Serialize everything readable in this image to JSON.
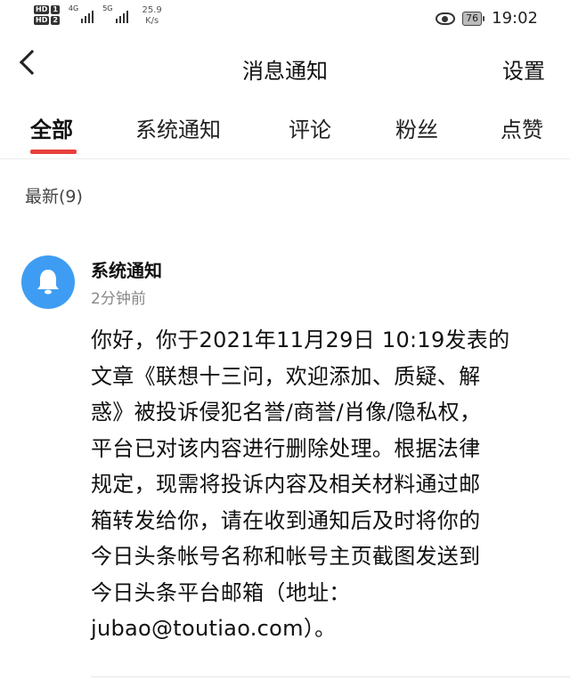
{
  "status_bar": {
    "hd1": "HD",
    "hd1_num": "1",
    "hd2": "HD",
    "hd2_num": "2",
    "net1": "4G",
    "net2": "5G",
    "speed_value": "25.9",
    "speed_unit": "K/s",
    "battery": "76",
    "time": "19:02"
  },
  "header": {
    "title": "消息通知",
    "settings_label": "设置"
  },
  "tabs": [
    {
      "label": "全部"
    },
    {
      "label": "系统通知"
    },
    {
      "label": "评论"
    },
    {
      "label": "粉丝"
    },
    {
      "label": "点赞"
    }
  ],
  "accent_color": "#e8403b",
  "avatar_color": "#3e9df2",
  "section_label": "最新(9)",
  "messages": [
    {
      "sender": "系统通知",
      "time": "2分钟前",
      "icon": "bell-icon",
      "content": "你好，你于2021年11月29日 10:19发表的\n文章《联想十三问，欢迎添加、质疑、解\n惑》被投诉侵犯名誉/商誉/肖像/隐私权，\n平台已对该内容进行删除处理。根据法律\n规定，现需将投诉内容及相关材料通过邮\n箱转发给你，请在收到通知后及时将你的\n今日头条帐号名称和帐号主页截图发送到\n今日头条平台邮箱（地址：\njubao@toutiao.com）。"
    }
  ]
}
